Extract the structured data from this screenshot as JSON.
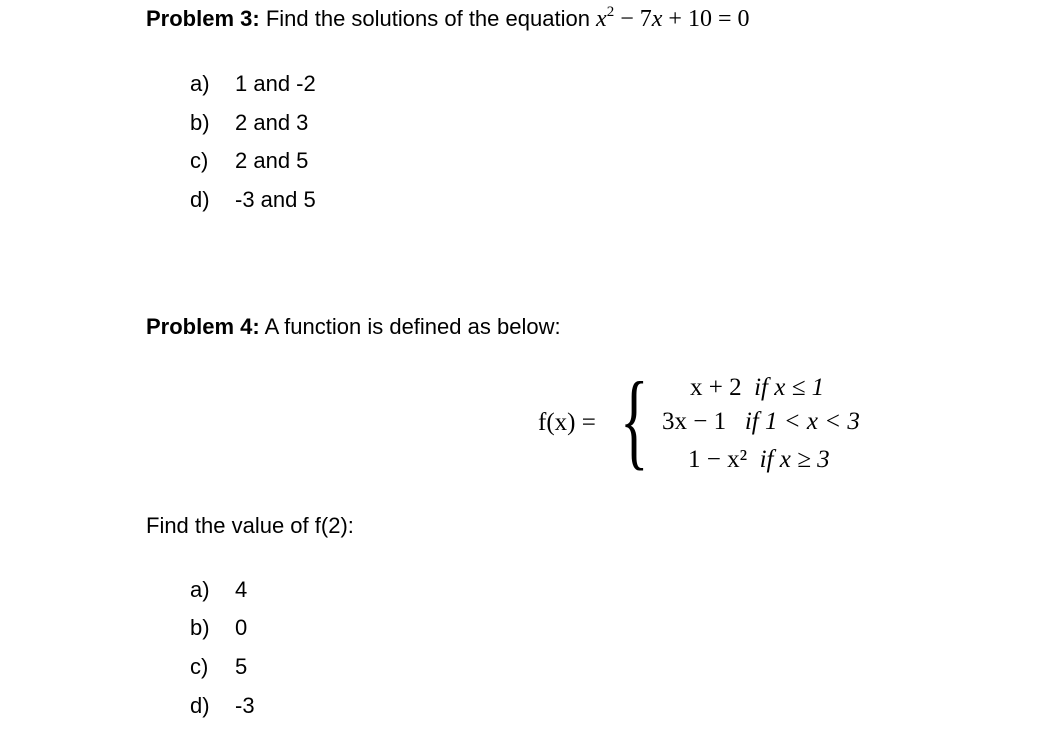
{
  "problem3": {
    "label": "Problem 3:",
    "text": " Find the solutions of the equation ",
    "equation": {
      "x": "x",
      "exp": "2",
      "rest_op1": " − 7",
      "x2": "x",
      "rest_op2": " + 10 = 0"
    },
    "options": [
      {
        "letter": "a)",
        "text": "1 and -2"
      },
      {
        "letter": "b)",
        "text": "2 and 3"
      },
      {
        "letter": "c)",
        "text": "2 and 5"
      },
      {
        "letter": "d)",
        "text": "-3 and 5"
      }
    ]
  },
  "problem4": {
    "label": "Problem 4:",
    "text": " A function is defined as below:",
    "function": {
      "lhs": "f(x) =",
      "cases": [
        {
          "expr": "x + 2",
          "cond": "if x ≤ 1"
        },
        {
          "expr": "3x − 1",
          "cond": "if 1 < x < 3"
        },
        {
          "expr": "1 − x²",
          "cond": "if x ≥ 3"
        }
      ]
    },
    "question": "Find the value of f(2):",
    "options": [
      {
        "letter": "a)",
        "text": "4"
      },
      {
        "letter": "b)",
        "text": "0"
      },
      {
        "letter": "c)",
        "text": "5"
      },
      {
        "letter": "d)",
        "text": "-3"
      }
    ]
  }
}
